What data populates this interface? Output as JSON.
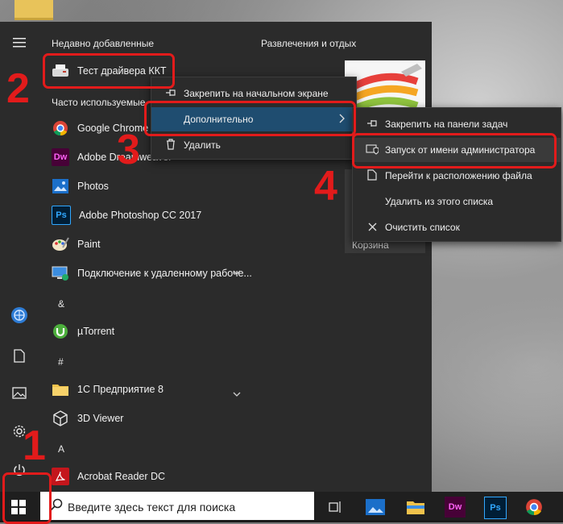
{
  "start_menu": {
    "recent_header": "Недавно добавленные",
    "frequent_header": "Часто используемые",
    "tiles_header": "Развлечения и отдых",
    "recent_apps": [
      {
        "label": "Тест драйвера ККТ",
        "icon": "printer-icon"
      }
    ],
    "frequent_apps": [
      {
        "label": "Google Chrome",
        "icon": "chrome-icon"
      },
      {
        "label": "Adobe Dreamweaver",
        "icon": "dreamweaver-icon",
        "icon_text": "Dw"
      },
      {
        "label": "Photos",
        "icon": "photos-icon"
      },
      {
        "label": "Adobe Photoshop CC 2017",
        "icon": "photoshop-icon",
        "icon_text": "Ps"
      },
      {
        "label": "Paint",
        "icon": "paint-icon"
      },
      {
        "label": "Подключение к удаленному рабоче...",
        "icon": "remote-desktop-icon"
      }
    ],
    "letters": [
      "&",
      "#",
      "A"
    ],
    "alpha_apps": [
      {
        "label": "µTorrent",
        "icon": "utorrent-icon"
      },
      {
        "label": "1С Предприятие 8",
        "icon": "folder-icon"
      },
      {
        "label": "3D Viewer",
        "icon": "3d-viewer-icon"
      },
      {
        "label": "Acrobat Reader DC",
        "icon": "acrobat-icon"
      }
    ],
    "recycle_label": "Корзина"
  },
  "context_menu": {
    "items": [
      {
        "label": "Закрепить на начальном экране",
        "icon": "pin-icon"
      },
      {
        "label": "Дополнительно",
        "icon": "none"
      },
      {
        "label": "Удалить",
        "icon": "trash-icon"
      }
    ]
  },
  "submenu": {
    "items": [
      {
        "label": "Закрепить на панели задач",
        "icon": "pin-taskbar-icon"
      },
      {
        "label": "Запуск от имени администратора",
        "icon": "shield-icon"
      },
      {
        "label": "Перейти к расположению файла",
        "icon": "file-location-icon"
      },
      {
        "label": "Удалить из этого списка",
        "icon": "none"
      },
      {
        "label": "Очистить список",
        "icon": "close-icon"
      }
    ]
  },
  "annotations": [
    "1",
    "2",
    "3",
    "4"
  ],
  "taskbar": {
    "search_placeholder": "Введите здесь текст для поиска",
    "dw_text": "Dw",
    "ps_text": "Ps"
  }
}
